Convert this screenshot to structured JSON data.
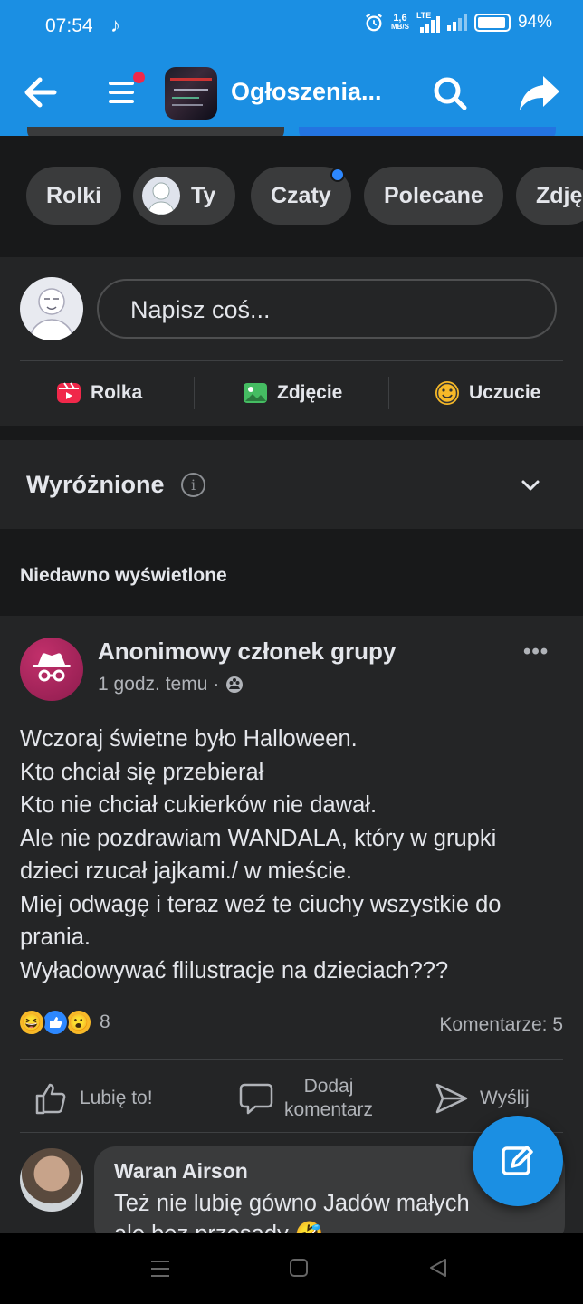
{
  "status_bar": {
    "time": "07:54",
    "tiktok_icon": "tiktok-icon",
    "speed_value": "1,6",
    "speed_unit": "MB/S",
    "network": "LTE",
    "battery": "94%"
  },
  "header": {
    "title": "Ogłoszenia...",
    "has_notification_dot": true,
    "colors": {
      "bar": "#1b8fe3",
      "notification": "#f02849"
    }
  },
  "chips": [
    {
      "label": "Rolki"
    },
    {
      "label": "Ty"
    },
    {
      "label": "Czaty"
    },
    {
      "label": "Polecane"
    },
    {
      "label": "Zdję"
    }
  ],
  "composer": {
    "placeholder": "Napisz coś...",
    "actions": [
      {
        "label": "Rolka",
        "icon": "reel-icon",
        "color": "#f0284a"
      },
      {
        "label": "Zdjęcie",
        "icon": "photo-icon",
        "color": "#45bd62"
      },
      {
        "label": "Uczucie",
        "icon": "smiley-icon",
        "color": "#f7b928"
      }
    ]
  },
  "featured": {
    "title": "Wyróżnione"
  },
  "recent_label": "Niedawno wyświetlone",
  "post": {
    "author": "Anonimowy członek grupy",
    "time": "1 godz. temu",
    "separator": "·",
    "privacy_icon": "group-icon",
    "body_lines": [
      "Wczoraj świetne było Halloween.",
      "Kto chciał się przebierał",
      "Kto nie chciał cukierków nie dawał.",
      "Ale nie pozdrawiam WANDALA, który w grupki",
      "dzieci rzucał jajkami./ w mieście.",
      "Miej odwagę i teraz weź te ciuchy wszystkie do",
      "prania.",
      "Wyładowywać flilustracje na dzieciach???"
    ],
    "reactions": [
      "haha",
      "like",
      "wow"
    ],
    "reaction_count": "8",
    "comments": "Komentarze: 5",
    "actions": {
      "like": "Lubię to!",
      "comment_line1": "Dodaj",
      "comment_line2": "komentarz",
      "send": "Wyślij"
    }
  },
  "comment": {
    "author": "Waran Airson",
    "line1": "Też nie lubię gówno Jadów małych",
    "line2": "ale bez przesady 🤣"
  }
}
